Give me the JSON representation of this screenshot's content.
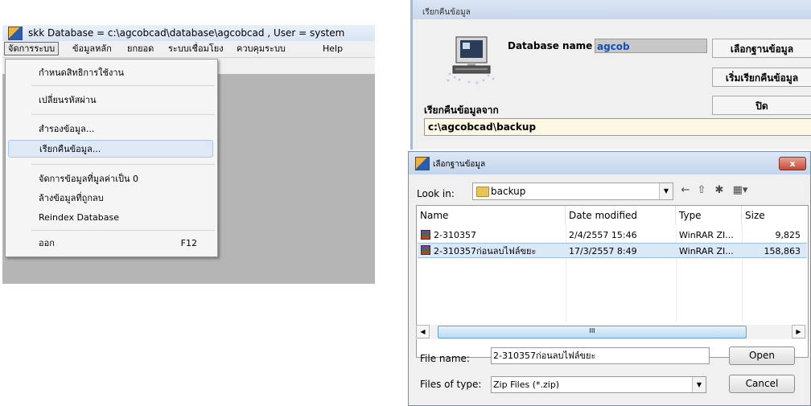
{
  "left_window": {
    "title": "skk  Database = c:\\agcobcad\\database\\agcobcad , User = system",
    "menu": [
      "จัดการระบบ",
      "ข้อมูลหลัก",
      "ยกยอด",
      "ระบบเชื่อมโยง",
      "ควบคุมระบบ",
      "Help"
    ],
    "dropdown": [
      {
        "label": "กำหนดสิทธิการใช้งาน"
      },
      {
        "label": "เปลี่ยนรหัสผ่าน"
      },
      {
        "label": "สำรองข้อมูล..."
      },
      {
        "label": "เรียกคืนข้อมูล..."
      },
      {
        "label": "จัดการข้อมูลที่มูลค่าเป็น 0"
      },
      {
        "label": "ล้างข้อมูลที่ถูกลบ"
      },
      {
        "label": "Reindex Database"
      },
      {
        "label": "ออก",
        "shortcut": "F12"
      }
    ]
  },
  "restore_window": {
    "title": "เรียกคืนข้อมูล",
    "db_name_label": "Database name :",
    "db_name_value": "agcob",
    "buttons": {
      "select_db": "เลือกฐานข้อมูล",
      "start_restore": "เริ่มเรียกคืนข้อมูล",
      "close": "ปิด"
    },
    "restore_from_label": "เรียกคืนข้อมูลจาก",
    "restore_from_path": "c:\\agcobcad\\backup"
  },
  "file_dialog": {
    "title": "เลือกฐานข้อมูล",
    "look_in_label": "Look in:",
    "look_in_value": "backup",
    "columns": [
      "Name",
      "Date modified",
      "Type",
      "Size"
    ],
    "files": [
      {
        "name": "2-310357",
        "date": "2/4/2557 15:46",
        "type": "WinRAR ZI...",
        "size": "9,825"
      },
      {
        "name": "2-310357ก่อนลบไฟล์ขยะ",
        "date": "17/3/2557 8:49",
        "type": "WinRAR ZI...",
        "size": "158,863"
      }
    ],
    "file_name_label": "File name:",
    "file_name_value": "2-310357ก่อนลบไฟล์ขยะ",
    "file_type_label": "Files of type:",
    "file_type_value": "Zip Files (*.zip)",
    "open_label": "Open",
    "cancel_label": "Cancel",
    "close_symbol": "x",
    "scroll_grip": "III"
  }
}
